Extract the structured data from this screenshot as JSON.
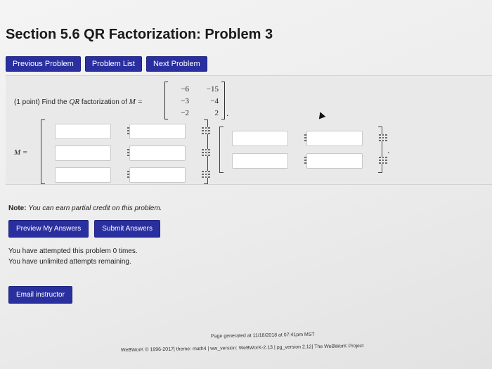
{
  "page": {
    "title": "Section 5.6 QR Factorization: Problem 3"
  },
  "nav": {
    "previous": "Previous Problem",
    "list": "Problem List",
    "next": "Next Problem"
  },
  "problem": {
    "points": "(1 point) Find the",
    "qr": "QR",
    "factorization_of": "factorization of",
    "m_equals": "M =",
    "matrix_label": "M =",
    "period": ".",
    "given_matrix": [
      [
        "−6",
        "−15"
      ],
      [
        "−3",
        "−4"
      ],
      [
        "−2",
        "2"
      ]
    ]
  },
  "note": {
    "label": "Note:",
    "text": "You can earn partial credit on this problem."
  },
  "actions": {
    "preview": "Preview My Answers",
    "submit": "Submit Answers"
  },
  "attempts": {
    "line1": "You have attempted this problem 0 times.",
    "line2": "You have unlimited attempts remaining."
  },
  "email": "Email instructor",
  "footer": {
    "generated": "Page generated at 11/18/2018 at 07:41pm MST",
    "credits": "WeBWorK © 1996-2017| theme: math4 | ww_version: WeBWorK-2.13 | pg_version 2.12| The WeBWorK Project"
  }
}
